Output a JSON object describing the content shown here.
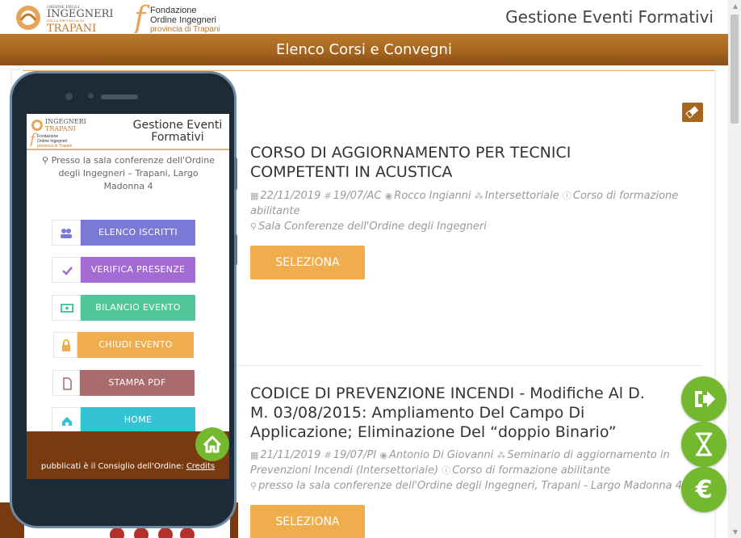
{
  "header": {
    "logo_ordine_lines": [
      "ORDINE DEGLI",
      "INGEGNERI",
      "DELLA PROVINCIA DI",
      "TRAPANI"
    ],
    "logo_fondazione_lines": [
      "Fondazione",
      "Ordine Ingegneri",
      "provincia di Trapani"
    ],
    "app_title": "Gestione Eventi Formativi"
  },
  "banner": {
    "title": "Elenco Corsi e Convegni"
  },
  "events": [
    {
      "title_lines": [
        "CORSO DI AGGIORNAMENTO PER TECNICI",
        "COMPETENTI IN ACUSTICA"
      ],
      "date": "22/11/2019",
      "code": "19/07/AC",
      "speaker": "Rocco Ingianni",
      "area": "Intersettoriale",
      "type_line1": "Corso di formazione",
      "type_line2": "abilitante",
      "location": "Sala Conferenze dell'Ordine degli Ingegneri",
      "button": "SELEZIONA"
    },
    {
      "title_lines": [
        "CODICE DI PREVENZIONE INCENDI - Modifiche Al D.",
        "M. 03/08/2015: Ampliamento Del Campo Di",
        "Applicazione; Eliminazione Del “doppio Binario”"
      ],
      "date": "21/11/2019",
      "code": "19/07/PI",
      "speaker": "Antonio Di Giovanni",
      "area_line1": "Seminario di aggiornamento in",
      "area_line2": "Prevenzioni Incendi (Intersettoriale)",
      "type": "Corso di formazione abilitante",
      "location": "presso la sala conferenze dell'Ordine degli Ingegneri, Trapani - Largo Madonna 4",
      "button": "SELEZIONA"
    }
  ],
  "phone": {
    "title_lines": [
      "Gestione Eventi",
      "Formativi"
    ],
    "logo_lines": [
      "INGEGNERI",
      "TRAPANI",
      "Fondazione",
      "Ordine Ingegneri",
      "provincia di Trapani"
    ],
    "address_lines": [
      "Presso la sala conferenze dell'Ordine",
      "degli Ingegneri – Trapani, Largo",
      "Madonna 4"
    ],
    "menu": [
      {
        "label": "ELENCO ISCRITTI",
        "icon": "users-icon",
        "color": "#7b79d6"
      },
      {
        "label": "VERIFICA PRESENZE",
        "icon": "check-icon",
        "color": "#a36bd3"
      },
      {
        "label": "BILANCIO EVENTO",
        "icon": "money-icon",
        "color": "#50c79a"
      },
      {
        "label": "CHIUDI EVENTO",
        "icon": "lock-icon",
        "color": "#f0ad4e"
      },
      {
        "label": "STAMPA PDF",
        "icon": "pdf-icon",
        "color": "#a96b6b"
      },
      {
        "label": "HOME",
        "icon": "home-icon",
        "color": "#33c3d3"
      }
    ],
    "credits_text": "pubblicati è il Consiglio dell'Ordine:",
    "credits_link": "Credits"
  },
  "colors": {
    "brand_brown": "#a7651e",
    "action_orange": "#f0ad4e",
    "fab_green": "#73b82e"
  }
}
